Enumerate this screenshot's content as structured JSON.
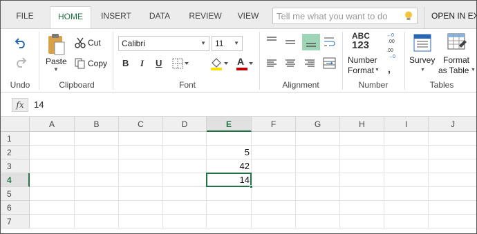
{
  "tabs": [
    "FILE",
    "HOME",
    "INSERT",
    "DATA",
    "REVIEW",
    "VIEW"
  ],
  "active_tab": "HOME",
  "tell_me": {
    "placeholder": "Tell me what you want to do"
  },
  "open_in": "OPEN IN EX",
  "ribbon": {
    "undo": {
      "group_label": "Undo"
    },
    "clipboard": {
      "paste": "Paste",
      "cut": "Cut",
      "copy": "Copy",
      "group_label": "Clipboard"
    },
    "font": {
      "font_name": "Calibri",
      "font_size": "11",
      "bold": "B",
      "italic": "I",
      "underline": "U",
      "font_color_letter": "A",
      "group_label": "Font"
    },
    "alignment": {
      "group_label": "Alignment"
    },
    "number": {
      "abc": "ABC",
      "abc_digits": "123",
      "number_format_line1": "Number",
      "number_format_line2": "Format",
      "group_label": "Number"
    },
    "tables": {
      "survey": "Survey",
      "format_line1": "Format",
      "format_line2": "as Table",
      "group_label": "Tables"
    }
  },
  "formula_bar": {
    "fx": "fx",
    "value": "14"
  },
  "grid": {
    "columns": [
      "A",
      "B",
      "C",
      "D",
      "E",
      "F",
      "G",
      "H",
      "I",
      "J"
    ],
    "rows": [
      "1",
      "2",
      "3",
      "4",
      "5",
      "6",
      "7"
    ],
    "selected_column": "E",
    "selected_row": "4",
    "cells": [
      {
        "ref": "E2",
        "value": "5"
      },
      {
        "ref": "E3",
        "value": "42"
      },
      {
        "ref": "E4",
        "value": "14"
      }
    ]
  },
  "colors": {
    "accent": "#217346",
    "tab_bar": "#ececec",
    "header_bg": "#efefef"
  }
}
